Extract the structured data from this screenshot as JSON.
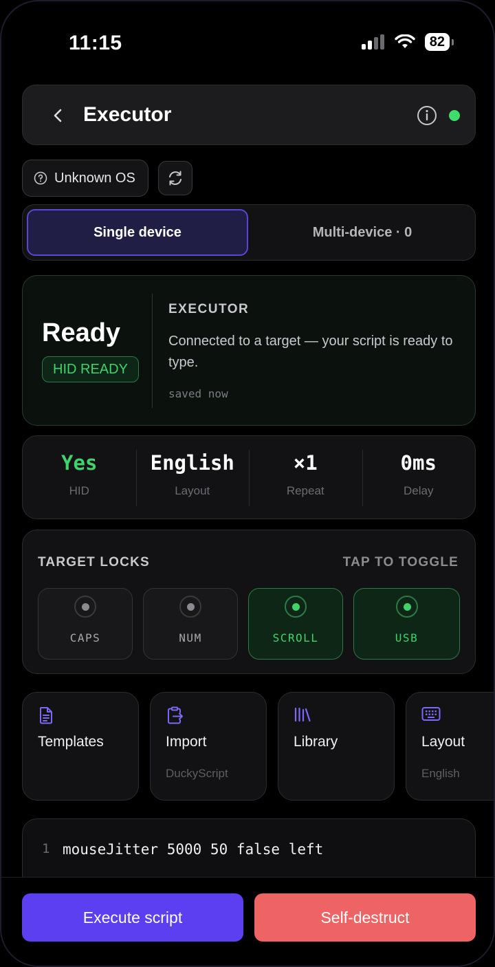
{
  "status_bar": {
    "time": "11:15",
    "battery": "82",
    "signal_icon": "signal-bars-icon",
    "wifi_icon": "wifi-icon"
  },
  "header": {
    "title": "Executor",
    "back_icon": "chevron-left-icon",
    "info_icon": "info-icon",
    "connection_status": "connected"
  },
  "os_chip": {
    "label": "Unknown OS",
    "icon": "question-circle-icon"
  },
  "refresh_icon": "refresh-icon",
  "mode_tabs": {
    "single": "Single device",
    "multi": "Multi-device · 0",
    "selected": "single"
  },
  "executor": {
    "state": "Ready",
    "badge": "HID READY",
    "section_label": "EXECUTOR",
    "description": "Connected to a target — your script is ready to type.",
    "saved": "saved now"
  },
  "stats": [
    {
      "value": "Yes",
      "label": "HID"
    },
    {
      "value": "English",
      "label": "Layout"
    },
    {
      "value": "×1",
      "label": "Repeat"
    },
    {
      "value": "0ms",
      "label": "Delay"
    }
  ],
  "locks": {
    "title": "TARGET LOCKS",
    "hint": "TAP TO TOGGLE",
    "items": [
      {
        "label": "CAPS",
        "on": false
      },
      {
        "label": "NUM",
        "on": false
      },
      {
        "label": "SCROLL",
        "on": true
      },
      {
        "label": "USB",
        "on": true
      }
    ]
  },
  "quick_actions": [
    {
      "title": "Templates",
      "subtitle": "",
      "icon": "document-icon"
    },
    {
      "title": "Import",
      "subtitle": "DuckyScript",
      "icon": "clipboard-import-icon"
    },
    {
      "title": "Library",
      "subtitle": "",
      "icon": "library-icon"
    },
    {
      "title": "Layout",
      "subtitle": "English",
      "icon": "keyboard-icon"
    }
  ],
  "editor": {
    "lines": [
      {
        "number": "1",
        "code": "mouseJitter 5000 50 false left"
      }
    ]
  },
  "actions": {
    "execute": "Execute script",
    "destruct": "Self-destruct"
  },
  "colors": {
    "accent": "#5b3ff0",
    "danger": "#ee6363",
    "success": "#40d36c",
    "background": "#000000"
  }
}
